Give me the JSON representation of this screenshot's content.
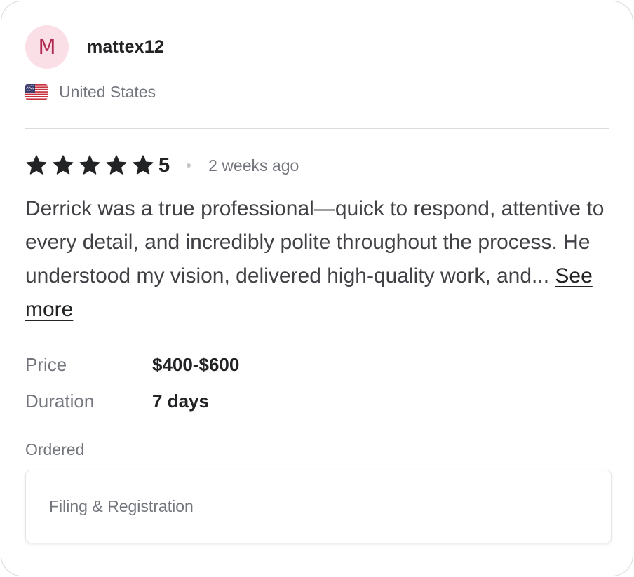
{
  "user": {
    "avatar_initial": "M",
    "username": "mattex12",
    "country": "United States",
    "flag_icon": "us-flag-icon",
    "avatar_bg": "#fbdfe7",
    "avatar_fg": "#b02a52"
  },
  "review": {
    "stars": 5,
    "rating": "5",
    "time_ago": "2 weeks ago",
    "text": "Derrick was a true professional—quick to respond, attentive to every detail, and incredibly polite throughout the process. He understood my vision, delivered high-quality work, and...",
    "see_more_label": "See more"
  },
  "details": {
    "price_label": "Price",
    "price_value": "$400-$600",
    "duration_label": "Duration",
    "duration_value": "7 days"
  },
  "ordered": {
    "label": "Ordered",
    "item": "Filing & Registration"
  }
}
